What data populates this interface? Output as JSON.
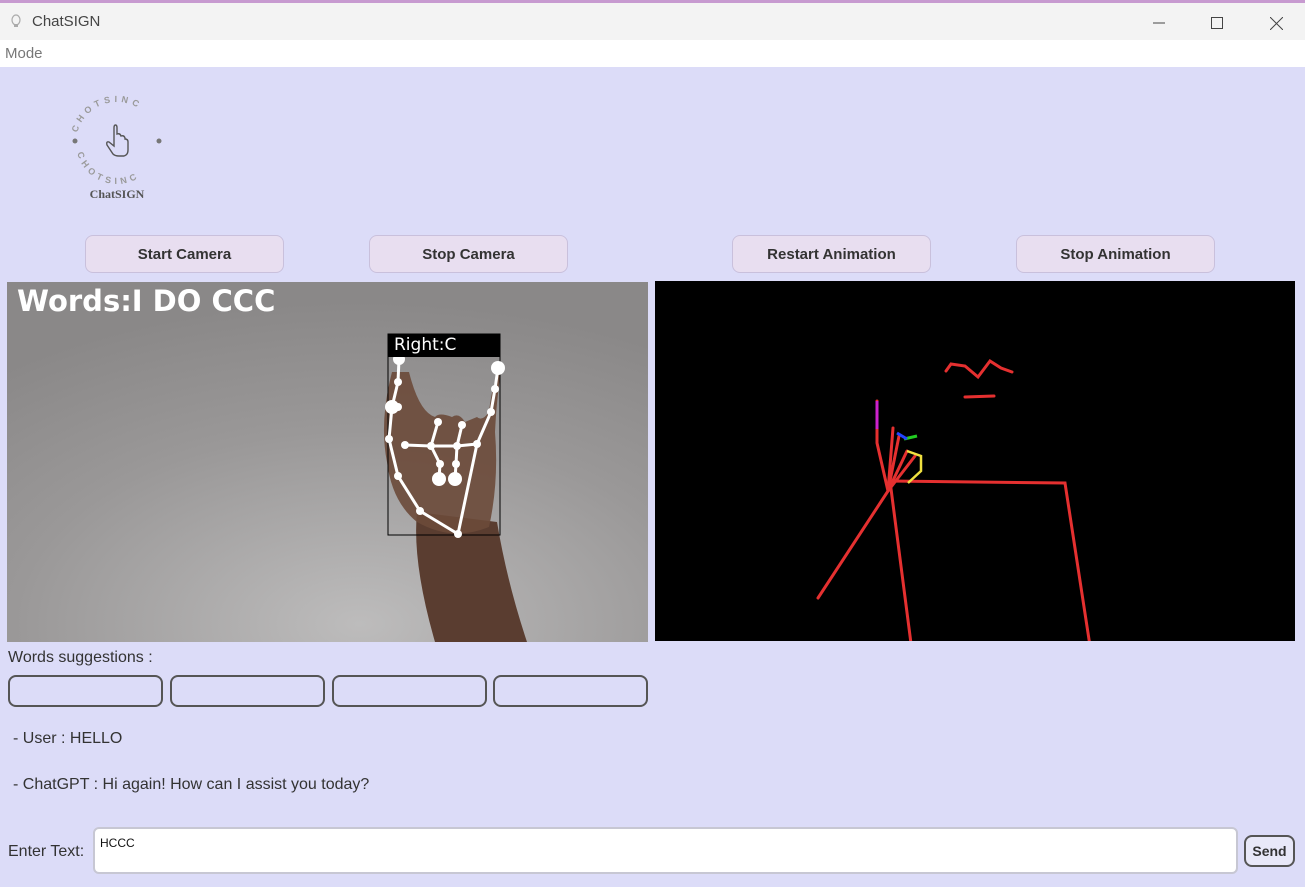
{
  "window": {
    "title": "ChatSIGN"
  },
  "menu": {
    "items": [
      "Mode"
    ]
  },
  "logo": {
    "label": "ChatSIGN",
    "ring_text": "CHOTSINC CHOTSINC"
  },
  "buttons": {
    "start_camera": "Start Camera",
    "stop_camera": "Stop Camera",
    "restart_animation": "Restart Animation",
    "stop_animation": "Stop Animation"
  },
  "camera": {
    "words_overlay": "Words:I DO CCC",
    "hand_label": "Right:C"
  },
  "suggestions": {
    "title": "Words suggestions :",
    "boxes": [
      "",
      "",
      "",
      ""
    ]
  },
  "chat": [
    {
      "text": "- User : HELLO"
    },
    {
      "text": "- ChatGPT : Hi again! How can I assist you today?"
    }
  ],
  "input": {
    "label": "Enter Text:",
    "value": "HCCC"
  },
  "send": {
    "label": "Send"
  },
  "colors": {
    "background": "#dcdcf8",
    "button": "#e8def0",
    "skeleton": "#e53030"
  }
}
